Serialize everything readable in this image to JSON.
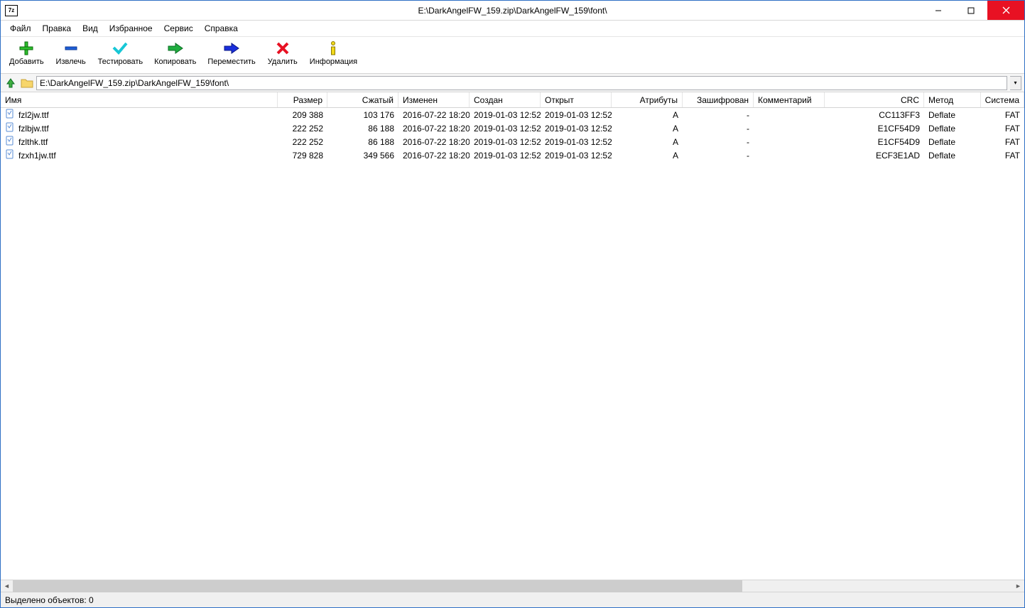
{
  "window": {
    "title": "E:\\DarkAngelFW_159.zip\\DarkAngelFW_159\\font\\",
    "app_icon_text": "7z"
  },
  "menu": {
    "file": "Файл",
    "edit": "Правка",
    "view": "Вид",
    "favorites": "Избранное",
    "tools": "Сервис",
    "help": "Справка"
  },
  "toolbar": {
    "add": "Добавить",
    "extract": "Извлечь",
    "test": "Тестировать",
    "copy": "Копировать",
    "move": "Переместить",
    "delete": "Удалить",
    "info": "Информация"
  },
  "address": {
    "path": "E:\\DarkAngelFW_159.zip\\DarkAngelFW_159\\font\\"
  },
  "columns": {
    "name": "Имя",
    "size": "Размер",
    "packed": "Сжатый",
    "modified": "Изменен",
    "created": "Создан",
    "accessed": "Открыт",
    "attributes": "Атрибуты",
    "encrypted": "Зашифрован",
    "comment": "Комментарий",
    "crc": "CRC",
    "method": "Метод",
    "system": "Система"
  },
  "files": [
    {
      "name": "fzl2jw.ttf",
      "size": "209 388",
      "packed": "103 176",
      "modified": "2016-07-22 18:20",
      "created": "2019-01-03 12:52",
      "accessed": "2019-01-03 12:52",
      "attributes": "A",
      "encrypted": "-",
      "comment": "",
      "crc": "CC113FF3",
      "method": "Deflate",
      "system": "FAT",
      "selected": true
    },
    {
      "name": "fzlbjw.ttf",
      "size": "222 252",
      "packed": "86 188",
      "modified": "2016-07-22 18:20",
      "created": "2019-01-03 12:52",
      "accessed": "2019-01-03 12:52",
      "attributes": "A",
      "encrypted": "-",
      "comment": "",
      "crc": "E1CF54D9",
      "method": "Deflate",
      "system": "FAT",
      "selected": false
    },
    {
      "name": "fzlthk.ttf",
      "size": "222 252",
      "packed": "86 188",
      "modified": "2016-07-22 18:20",
      "created": "2019-01-03 12:52",
      "accessed": "2019-01-03 12:52",
      "attributes": "A",
      "encrypted": "-",
      "comment": "",
      "crc": "E1CF54D9",
      "method": "Deflate",
      "system": "FAT",
      "selected": false
    },
    {
      "name": "fzxh1jw.ttf",
      "size": "729 828",
      "packed": "349 566",
      "modified": "2016-07-22 18:20",
      "created": "2019-01-03 12:52",
      "accessed": "2019-01-03 12:52",
      "attributes": "A",
      "encrypted": "-",
      "comment": "",
      "crc": "ECF3E1AD",
      "method": "Deflate",
      "system": "FAT",
      "selected": false
    }
  ],
  "status": {
    "selected_text": "Выделено объектов: 0"
  }
}
